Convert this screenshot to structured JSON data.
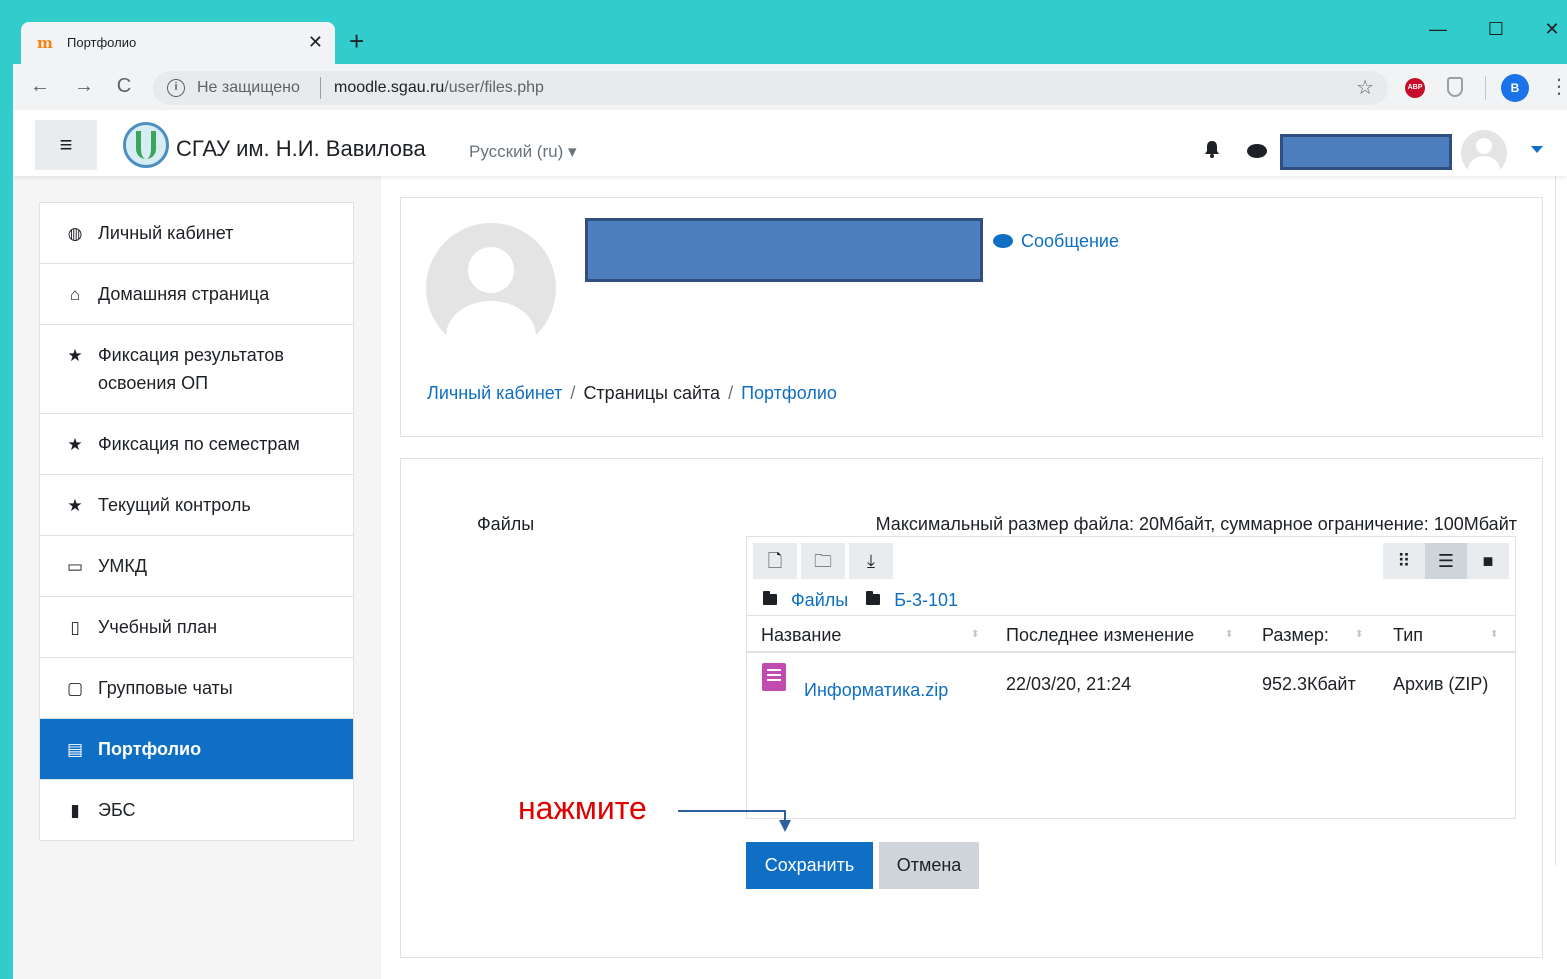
{
  "browser": {
    "tab_title": "Портфолио",
    "tab_close": "✕",
    "new_tab": "+",
    "window_controls": {
      "minimize": "—",
      "maximize": "☐",
      "close": "✕"
    },
    "nav": {
      "back": "←",
      "forward": "→",
      "reload": "C"
    },
    "omnibox": {
      "info": "i",
      "security_label": "Не защищено",
      "host": "moodle.sgau.ru",
      "path": "/user/files.php"
    },
    "star": "☆",
    "extension_abp": "ABP",
    "profile_letter": "B",
    "menu": "⋮"
  },
  "navbar": {
    "menu_toggle": "≡",
    "site_name": "СГАУ им. Н.И. Вавилова",
    "language": "Русский (ru) ▾"
  },
  "sidebar": {
    "items": [
      {
        "label": "Личный кабинет",
        "icon": "tachometer-icon",
        "glyph": "◍",
        "active": false
      },
      {
        "label": "Домашняя страница",
        "icon": "home-icon",
        "glyph": "⌂",
        "active": false
      },
      {
        "label": "Фиксация результатов освоения ОП",
        "icon": "star-icon",
        "glyph": "★",
        "active": false
      },
      {
        "label": "Фиксация по семестрам",
        "icon": "star-icon",
        "glyph": "★",
        "active": false
      },
      {
        "label": "Текущий контроль",
        "icon": "star-icon",
        "glyph": "★",
        "active": false
      },
      {
        "label": "УМКД",
        "icon": "laptop-icon",
        "glyph": "▭",
        "active": false
      },
      {
        "label": "Учебный план",
        "icon": "clipboard-icon",
        "glyph": "▯",
        "active": false
      },
      {
        "label": "Групповые чаты",
        "icon": "comment-icon",
        "glyph": "▢",
        "active": false
      },
      {
        "label": "Портфолио",
        "icon": "id-card-icon",
        "glyph": "▤",
        "active": true
      },
      {
        "label": "ЭБС",
        "icon": "book-icon",
        "glyph": "▮",
        "active": false
      }
    ]
  },
  "header": {
    "message_link": "Сообщение",
    "breadcrumb": [
      "Личный кабинет",
      "Страницы сайта",
      "Портфолио"
    ],
    "breadcrumb_sep": "/"
  },
  "files": {
    "label": "Файлы",
    "max_size": "Максимальный размер файла: 20Мбайт, суммарное ограничение: 100Мбайт",
    "toolbar": {
      "add_file": "🗋",
      "new_folder": "🗀",
      "download": "⤓"
    },
    "views": {
      "icons": "⠿",
      "list": "☰",
      "tree": "■"
    },
    "path": [
      "Файлы",
      "Б-3-101"
    ],
    "columns": [
      "Название",
      "Последнее изменение",
      "Размер:",
      "Тип"
    ],
    "sort_glyph": "⬍",
    "rows": [
      {
        "name": "Информатика.zip",
        "modified": "22/03/20, 21:24",
        "size": "952.3Кбайт",
        "type": "Архив (ZIP)"
      }
    ],
    "save_label": "Сохранить",
    "cancel_label": "Отмена"
  },
  "annotation": {
    "text": "нажмите"
  },
  "colors": {
    "accent": "#0f6fc5",
    "frame": "#33cccc",
    "annotation": "#e00000",
    "redaction": "#4d7ebd"
  }
}
